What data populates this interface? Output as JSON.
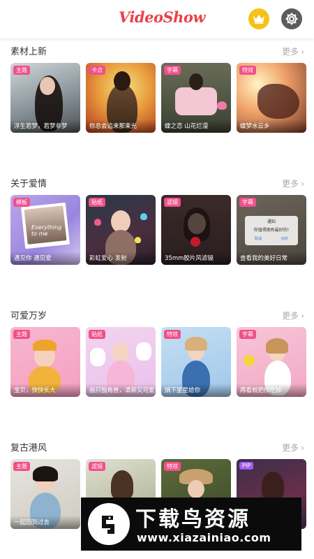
{
  "header": {
    "logo_text": "VideoShow",
    "accent": "#e8424a",
    "crown_color": "#f6c21a",
    "crown_icon": "crown-icon",
    "settings_icon": "gear-icon"
  },
  "sections": [
    {
      "title": "素材上新",
      "more": "更多",
      "cards": [
        {
          "tag": "主题",
          "tag_color": "#f0508a",
          "caption": "浮生若梦，若梦非梦"
        },
        {
          "tag": "卡点",
          "tag_color": "#f0508a",
          "caption": "你总会追来那束光"
        },
        {
          "tag": "字幕",
          "tag_color": "#f0508a",
          "caption": "蝶之恋  山花烂漫"
        },
        {
          "tag": "特效",
          "tag_color": "#f0508a",
          "caption": "蝶梦水云乡"
        }
      ]
    },
    {
      "title": "关于爱情",
      "more": "更多",
      "cards": [
        {
          "tag": "模板",
          "tag_color": "#f0508a",
          "caption": "遇见你 遇见爱"
        },
        {
          "tag": "贴纸",
          "tag_color": "#f0508a",
          "caption": "彩虹爱心 发射"
        },
        {
          "tag": "滤镜",
          "tag_color": "#f0508a",
          "caption": "35mm胶片风滤镜"
        },
        {
          "tag": "字幕",
          "tag_color": "#f0508a",
          "caption": "查看我的美好日常"
        }
      ]
    },
    {
      "title": "可爱万岁",
      "more": "更多",
      "cards": [
        {
          "tag": "主题",
          "tag_color": "#f0508a",
          "caption": "宝贝，快快长大"
        },
        {
          "tag": "贴纸",
          "tag_color": "#f0508a",
          "caption": "画只独角兽，清新又可爱"
        },
        {
          "tag": "特效",
          "tag_color": "#f0508a",
          "caption": "摘下星星给你"
        },
        {
          "tag": "字幕",
          "tag_color": "#f0508a",
          "caption": "再看就把你吃掉"
        }
      ]
    },
    {
      "title": "复古港风",
      "more": "更多",
      "cards": [
        {
          "tag": "主题",
          "tag_color": "#f0508a",
          "caption": "一起回到过去"
        },
        {
          "tag": "滤镜",
          "tag_color": "#f0508a",
          "caption": ""
        },
        {
          "tag": "特效",
          "tag_color": "#f0508a",
          "caption": ""
        },
        {
          "tag": "PIP",
          "tag_color": "#a35cf0",
          "caption": ""
        }
      ]
    }
  ],
  "card_overlays": {
    "notify_title": "通知",
    "notify_body": "你值得拥有最好的!",
    "notify_cancel": "取消",
    "notify_ok": "好的",
    "everything": "Everything to me"
  },
  "watermark": {
    "title": "下载鸟资源",
    "url": "www.xiazainiao.com"
  }
}
